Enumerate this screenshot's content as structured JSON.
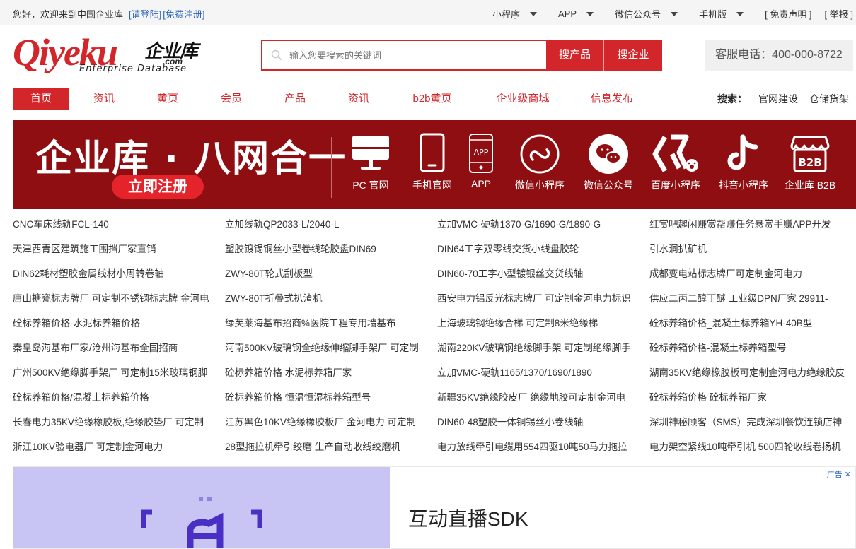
{
  "topbar": {
    "greeting": "您好，欢迎来到中国企业库",
    "login": "[请登陆]",
    "register": "[免费注册]",
    "menus": [
      "小程序",
      "APP",
      "微信公众号",
      "手机版"
    ],
    "links": [
      "[ 免责声明 ]",
      "[ 举报 ]"
    ]
  },
  "logo": {
    "main": "Qiyeku",
    "cn": "企业库",
    "com": ".com",
    "en": "Enterprise Database"
  },
  "search": {
    "placeholder": "输入您要搜索的关键词",
    "btn_product": "搜产品",
    "btn_company": "搜企业"
  },
  "hotline": "客服电话：400-000-8722",
  "nav": {
    "items": [
      "首页",
      "资讯",
      "黄页",
      "会员",
      "产品",
      "资讯",
      "b2b黄页",
      "企业级商城",
      "信息发布"
    ],
    "search_label": "搜索：",
    "search_links": [
      "官网建设",
      "仓储货架"
    ]
  },
  "banner": {
    "headline": "企业库 · 八网合一",
    "cta": "立即注册",
    "icons": [
      {
        "label": "PC 官网",
        "icon": "monitor-icon"
      },
      {
        "label": "手机官网",
        "icon": "mobile-icon"
      },
      {
        "label": "APP",
        "icon": "app-icon"
      },
      {
        "label": "微信小程序",
        "icon": "wechat-miniprogram-icon"
      },
      {
        "label": "微信公众号",
        "icon": "wechat-icon"
      },
      {
        "label": "百度小程序",
        "icon": "baidu-icon"
      },
      {
        "label": "抖音小程序",
        "icon": "douyin-icon"
      },
      {
        "label": "企业库 B2B",
        "icon": "b2b-store-icon"
      }
    ],
    "b2b_text": "B2B",
    "app_text": "APP"
  },
  "links": [
    [
      "CNC车床线轨FCL-140",
      "立加线轨QP2033-L/2040-L",
      "立加VMC-硬轨1370-G/1690-G/1890-G",
      "红赏吧趣闲赚赏帮赚任务悬赏手赚APP开发"
    ],
    [
      "天津西青区建筑施工围挡厂家直销",
      "塑胶镀锡铜丝小型卷线轮胶盘DIN69",
      "DIN64工字双零线交货小线盘胶轮",
      "引水洞扒矿机"
    ],
    [
      "DIN62耗材塑胶金属线材小周转卷轴",
      "ZWY-80T轮式刮板型",
      "DIN60-70工字小型镀银丝交货线轴",
      "成都变电站标志牌厂可定制金河电力"
    ],
    [
      "唐山搪瓷标志牌厂 可定制不锈钢标志牌 金河电",
      "ZWY-80T折叠式扒渣机",
      "西安电力铝反光标志牌厂 可定制金河电力标识",
      "供应二丙二醇丁醚 工业级DPN厂家 29911-"
    ],
    [
      "砼标养箱价格-水泥标养箱价格",
      "绿芙莱海基布招商%医院工程专用墙基布",
      "上海玻璃钢绝缘合梯 可定制8米绝缘梯",
      "砼标养箱价格_混凝土标养箱YH-40B型"
    ],
    [
      "秦皇岛海基布厂家/沧州海基布全国招商",
      "河南500KV玻璃钢全绝缘伸缩脚手架厂 可定制",
      "湖南220KV玻璃钢绝缘脚手架 可定制绝缘脚手",
      "砼标养箱价格-混凝土标养箱型号"
    ],
    [
      "广州500KV绝缘脚手架厂 可定制15米玻璃钢脚",
      "砼标养箱价格 水泥标养箱厂家",
      "立加VMC-硬轨1165/1370/1690/1890",
      "湖南35KV绝缘橡胶板可定制金河电力绝缘胶皮"
    ],
    [
      "砼标养箱价格/混凝土标养箱价格",
      "砼标养箱价格 恒温恒湿标养箱型号",
      "新疆35KV绝缘胶皮厂 绝缘地胶可定制金河电",
      "砼标养箱价格 砼标养箱厂家"
    ],
    [
      "长春电力35KV绝缘橡胶板,绝缘胶垫厂 可定制",
      "江苏黑色10KV绝缘橡胶板厂 金河电力 可定制",
      "DIN60-48塑胶一体铜锡丝小卷线轴",
      "深圳神秘顾客（SMS）完成深圳餐饮连锁店神"
    ],
    [
      "浙江10KV验电器厂 可定制金河电力",
      "28型拖拉机牵引绞磨 生产自动收线绞磨机",
      "电力放线牵引电缆用554四驱10吨50马力拖拉",
      "电力架空紧线10吨牵引机 500四轮收线卷扬机"
    ]
  ],
  "ad": {
    "title": "互动直播SDK",
    "tag": "广告 ✕"
  },
  "colors": {
    "brand": "#d3262b",
    "banner_bg": "#8f0e11",
    "link": "#2a63b8"
  }
}
